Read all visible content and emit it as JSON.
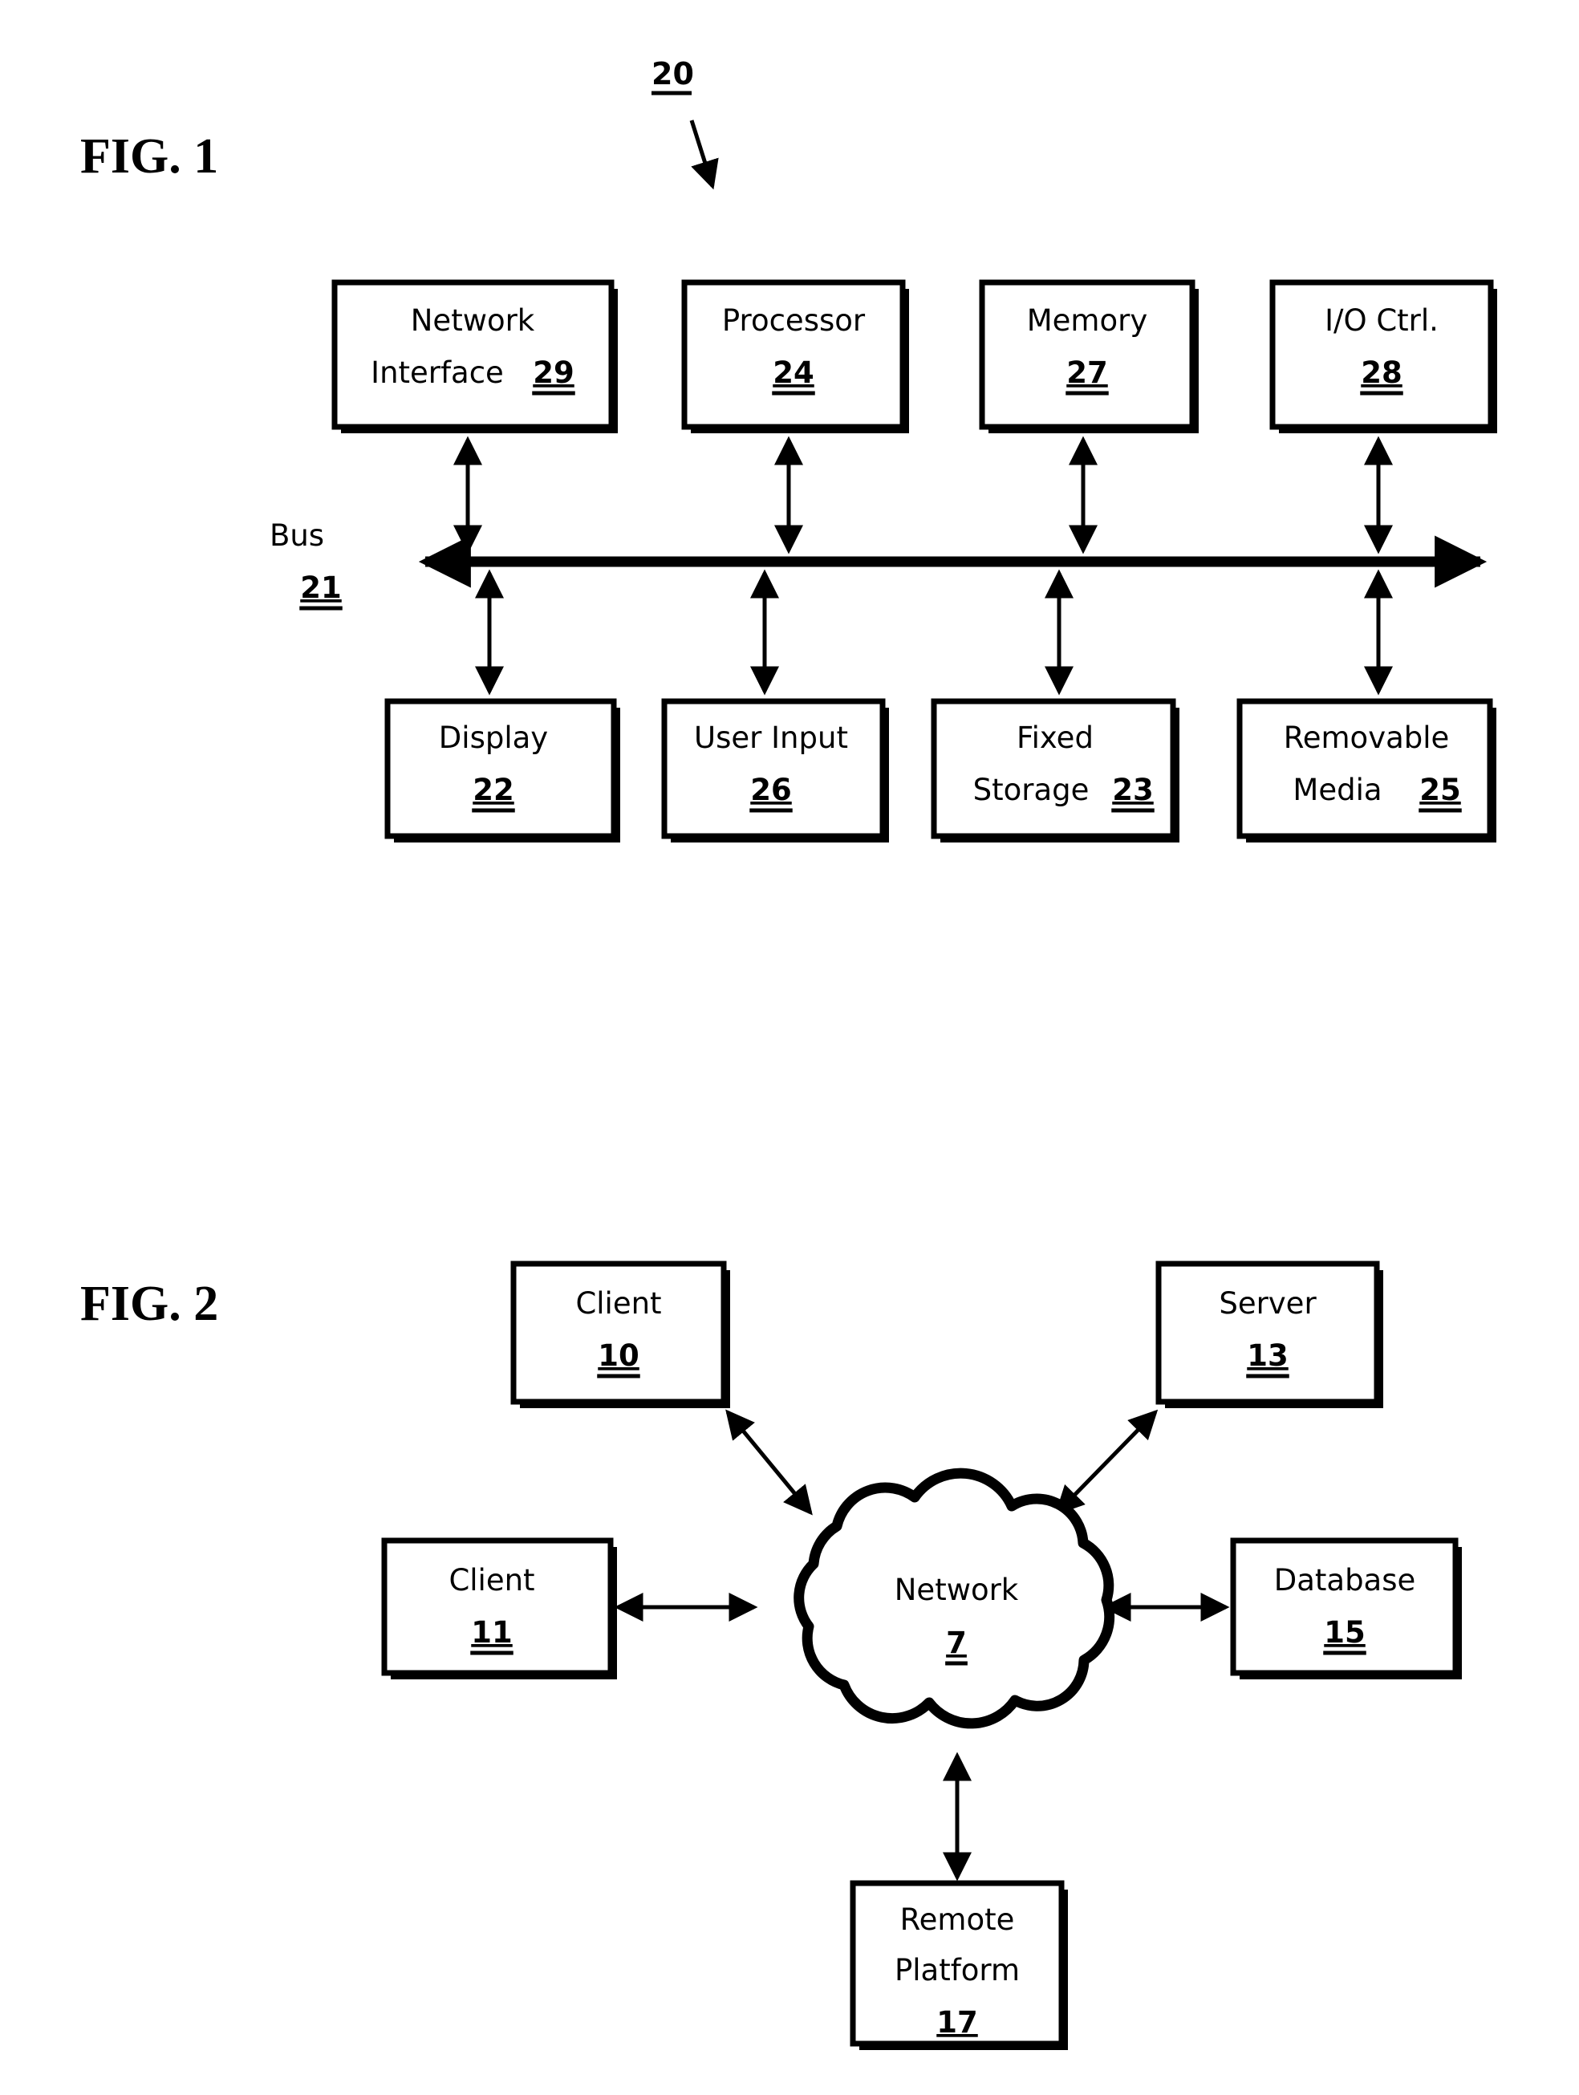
{
  "figures": [
    {
      "id": "fig1",
      "title": "FIG. 1",
      "lead_ref": "20",
      "bus": {
        "label": "Bus",
        "ref": "21"
      },
      "top_boxes": [
        {
          "name": "network-interface",
          "line1": "Network",
          "line2": "Interface",
          "ref": "29"
        },
        {
          "name": "processor",
          "line1": "Processor",
          "line2": "",
          "ref": "24"
        },
        {
          "name": "memory",
          "line1": "Memory",
          "line2": "",
          "ref": "27"
        },
        {
          "name": "io-ctrl",
          "line1": "I/O Ctrl.",
          "line2": "",
          "ref": "28"
        }
      ],
      "bottom_boxes": [
        {
          "name": "display",
          "line1": "Display",
          "line2": "",
          "ref": "22"
        },
        {
          "name": "user-input",
          "line1": "User Input",
          "line2": "",
          "ref": "26"
        },
        {
          "name": "fixed-storage",
          "line1": "Fixed",
          "line2": "Storage",
          "ref": "23"
        },
        {
          "name": "removable-media",
          "line1": "Removable",
          "line2": "Media",
          "ref": "25"
        }
      ]
    },
    {
      "id": "fig2",
      "title": "FIG. 2",
      "cloud": {
        "label": "Network",
        "ref": "7"
      },
      "nodes": [
        {
          "name": "client-10",
          "line1": "Client",
          "line2": "",
          "ref": "10"
        },
        {
          "name": "server-13",
          "line1": "Server",
          "line2": "",
          "ref": "13"
        },
        {
          "name": "client-11",
          "line1": "Client",
          "line2": "",
          "ref": "11"
        },
        {
          "name": "database-15",
          "line1": "Database",
          "line2": "",
          "ref": "15"
        },
        {
          "name": "remote-platform-17",
          "line1": "Remote",
          "line2": "Platform",
          "ref": "17"
        }
      ]
    }
  ],
  "colors": {
    "ink": "#000000",
    "paper": "#ffffff"
  }
}
